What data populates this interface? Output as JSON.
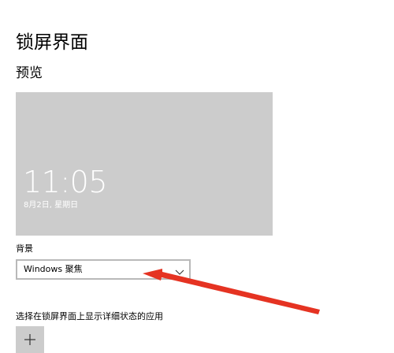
{
  "page": {
    "title": "锁屏界面",
    "preview_heading": "预览"
  },
  "preview": {
    "time": "11:05",
    "date": "8月2日, 星期日"
  },
  "background": {
    "label": "背景",
    "selected_value": "Windows 聚焦"
  },
  "apps": {
    "label": "选择在锁屏界面上显示详细状态的应用"
  },
  "icons": {
    "dropdown": "chevron-down-icon",
    "add": "plus-icon"
  },
  "colors": {
    "preview_bg": "#cccccc",
    "annotation_arrow": "#e53322"
  }
}
